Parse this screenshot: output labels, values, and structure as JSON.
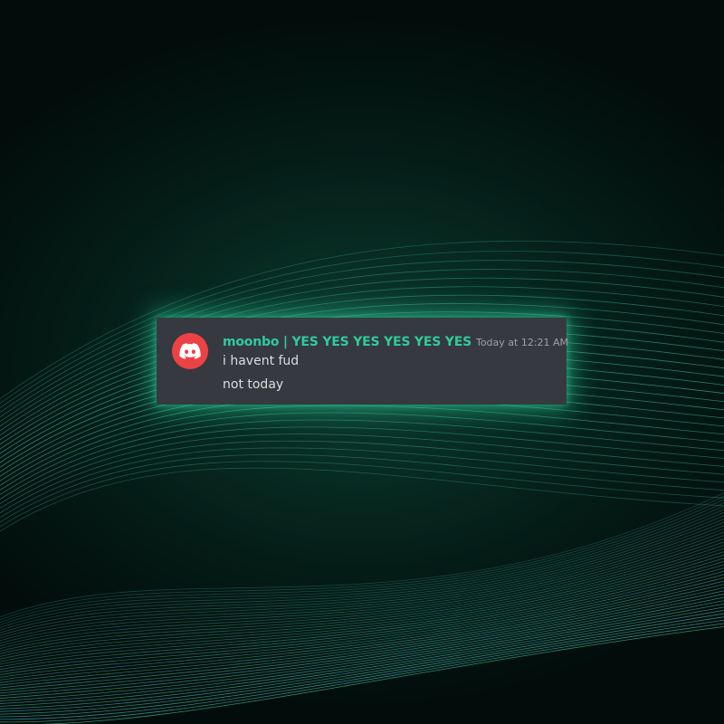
{
  "message": {
    "author": "moonbo | YES YES YES YES YES YES",
    "timestamp": "Today at 12:21 AM",
    "lines": [
      "i havent fud",
      "not today"
    ]
  },
  "avatar": {
    "icon": "discord-logo-icon",
    "background": "#ed4245"
  },
  "colors": {
    "username": "#2ecc9a",
    "card_background": "#36393f",
    "glow": "#2ed6a0",
    "wave_lines": "#3fb89a"
  }
}
